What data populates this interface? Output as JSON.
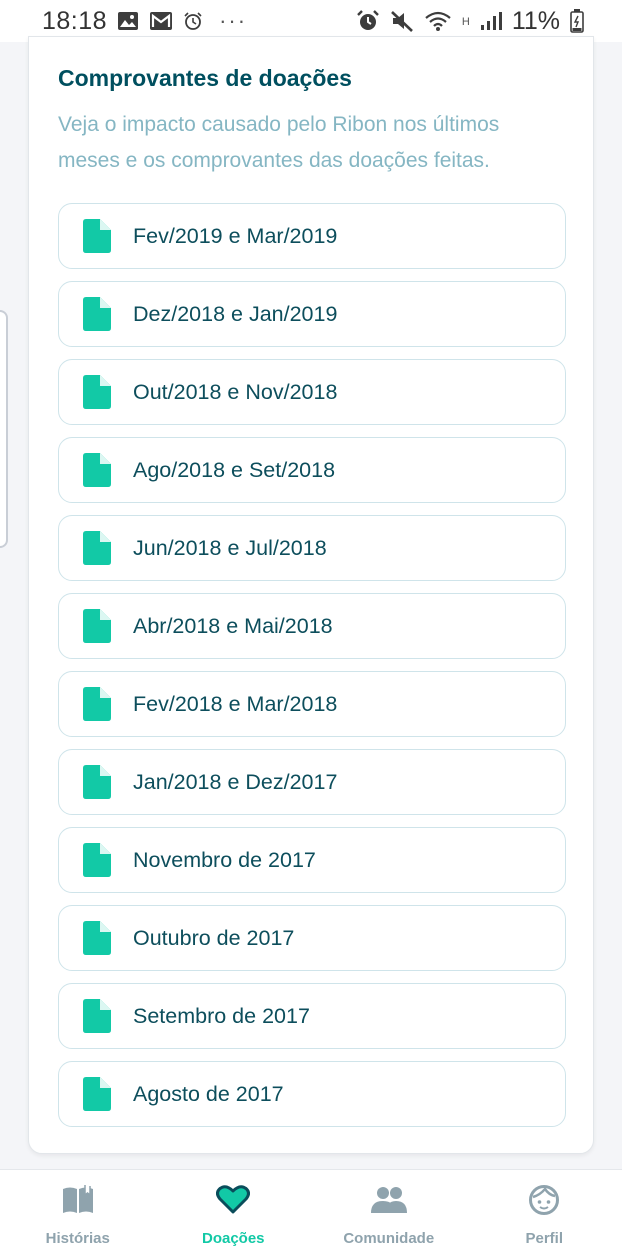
{
  "status_bar": {
    "time": "18:18",
    "dots": "···",
    "network_type": "H",
    "battery": "11%",
    "left_icons": [
      "image-icon",
      "mail-icon",
      "alarm-icon"
    ],
    "right_icons": [
      "alarm-icon",
      "mute-icon",
      "wifi-icon",
      "signal-icon",
      "battery-icon"
    ]
  },
  "card": {
    "title": "Comprovantes de doações",
    "subtitle": "Veja o impacto causado pelo Ribon nos últimos meses e os comprovantes das doações feitas."
  },
  "receipts": [
    {
      "label": "Fev/2019 e Mar/2019"
    },
    {
      "label": "Dez/2018 e Jan/2019"
    },
    {
      "label": "Out/2018 e Nov/2018"
    },
    {
      "label": "Ago/2018 e Set/2018"
    },
    {
      "label": "Jun/2018 e Jul/2018"
    },
    {
      "label": "Abr/2018 e Mai/2018"
    },
    {
      "label": "Fev/2018 e Mar/2018"
    },
    {
      "label": "Jan/2018 e Dez/2017"
    },
    {
      "label": "Novembro de 2017"
    },
    {
      "label": "Outubro de 2017"
    },
    {
      "label": "Setembro de 2017"
    },
    {
      "label": "Agosto de 2017"
    }
  ],
  "nav": {
    "items": [
      {
        "label": "Histórias",
        "icon": "book-icon",
        "active": false
      },
      {
        "label": "Doações",
        "icon": "heart-icon",
        "active": true
      },
      {
        "label": "Comunidade",
        "icon": "people-icon",
        "active": false
      },
      {
        "label": "Perfil",
        "icon": "face-icon",
        "active": false
      }
    ]
  },
  "colors": {
    "accent": "#12c9a6",
    "title": "#004f5f",
    "subtitle": "#85b6c3",
    "item_text": "#0d4e5c",
    "nav_inactive": "#8fa3ad"
  }
}
